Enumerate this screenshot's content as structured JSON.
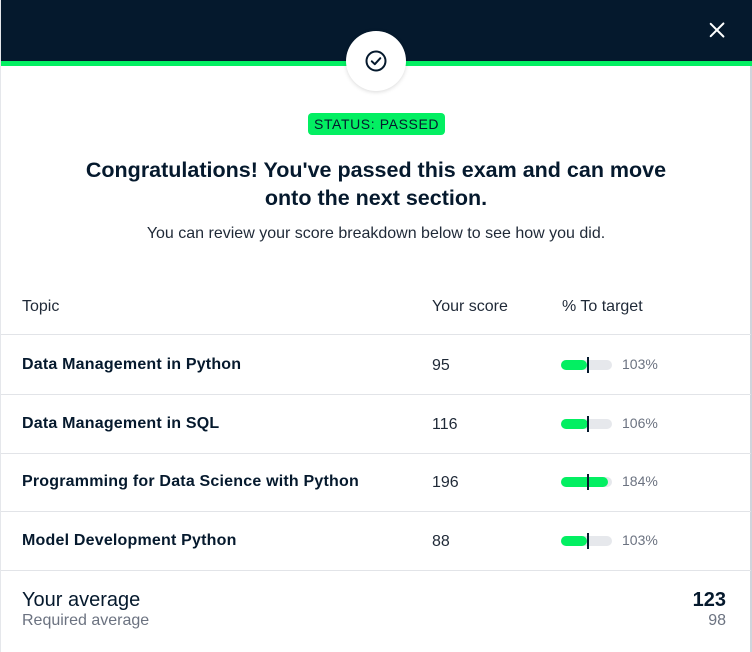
{
  "modal": {
    "status": "STATUS: PASSED",
    "headline_line1": "Congratulations! You've passed this exam and can move",
    "headline_line2": "onto the next section.",
    "subline": "You can review your score breakdown below to see how you did.",
    "close_icon": "close-icon",
    "badge_icon": "check-circle-icon"
  },
  "table": {
    "headers": {
      "topic": "Topic",
      "score": "Your score",
      "target": "% To target"
    },
    "rows": [
      {
        "topic": "Data Management in Python",
        "score": "95",
        "pct": "103%",
        "fraction": 0.5175
      },
      {
        "topic": "Data Management in SQL",
        "score": "116",
        "pct": "106%",
        "fraction": 0.53
      },
      {
        "topic": "Programming for Data Science with Python",
        "score": "196",
        "pct": "184%",
        "fraction": 0.92
      },
      {
        "topic": "Model Development Python",
        "score": "88",
        "pct": "103%",
        "fraction": 0.5175
      }
    ]
  },
  "summary": {
    "your_average_label": "Your average",
    "your_average_value": "123",
    "required_average_label": "Required average",
    "required_average_value": "98"
  },
  "colors": {
    "header_bg": "#05192d",
    "accent_green": "#03ef62",
    "bar_track": "#e6e8ec"
  }
}
